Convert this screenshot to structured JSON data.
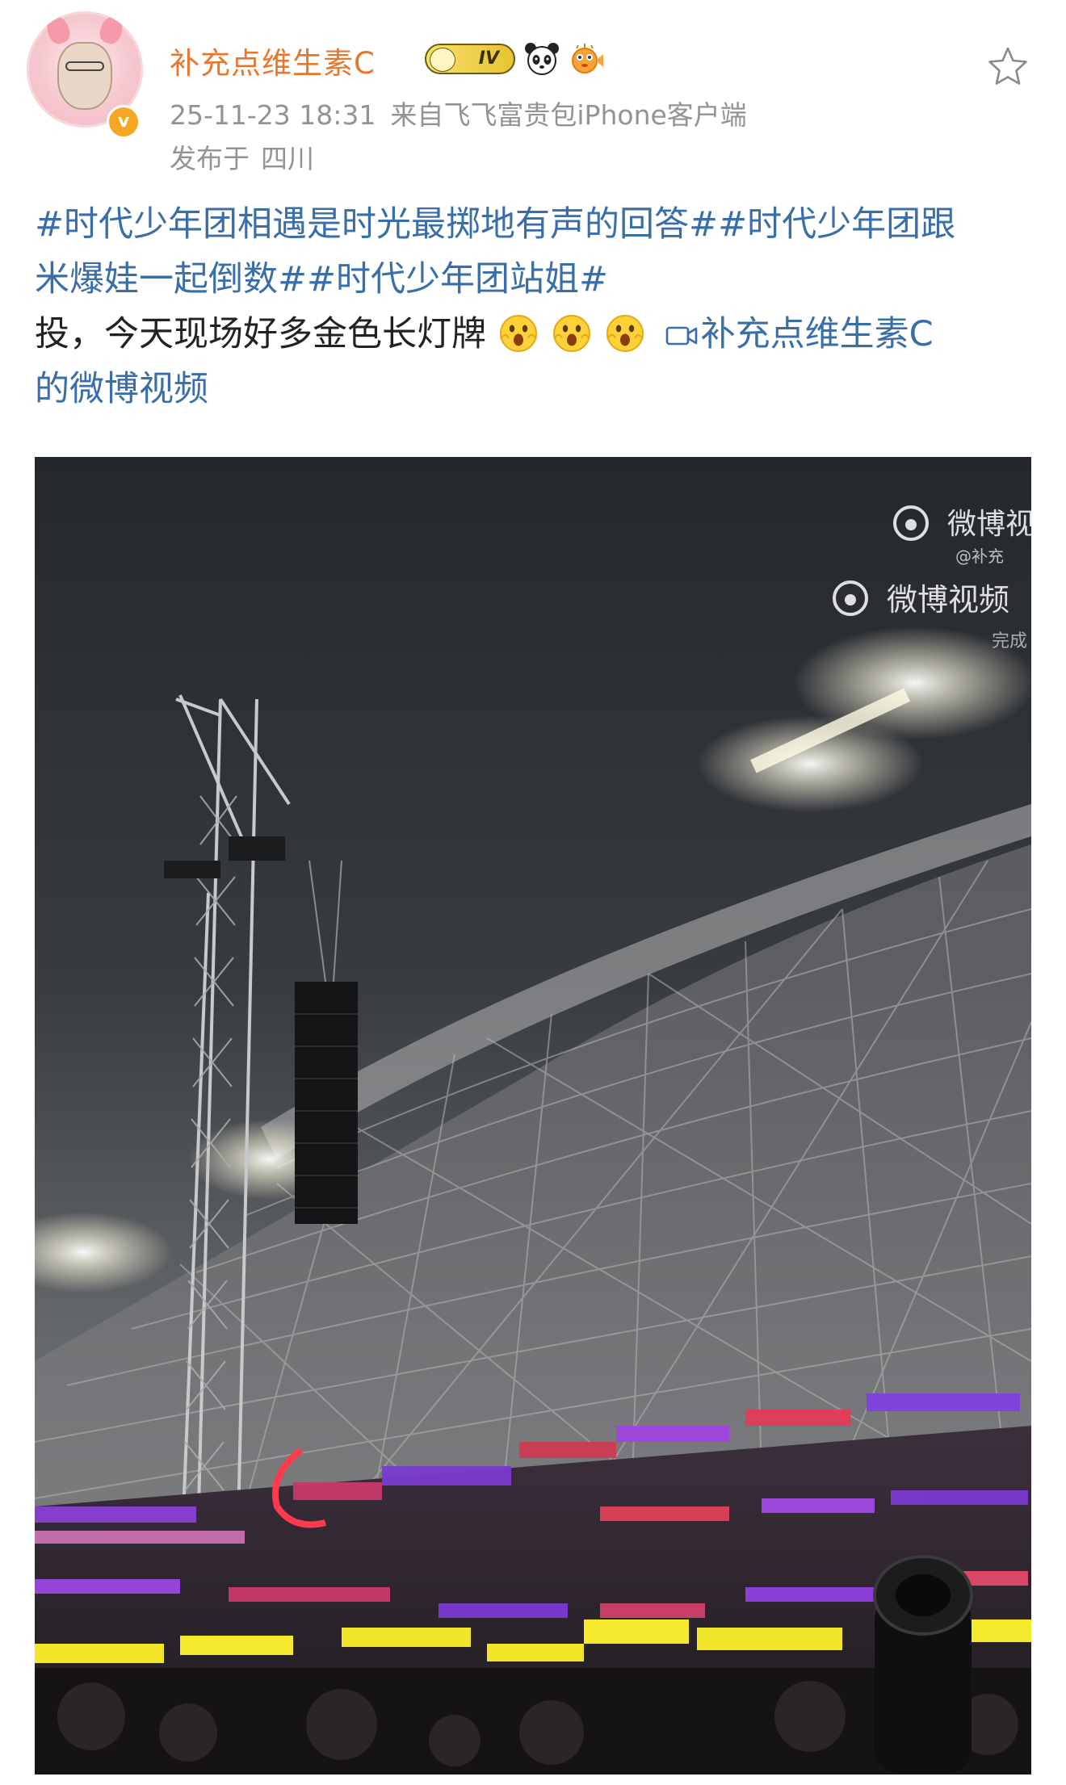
{
  "user": {
    "name": "补充点维生素C",
    "level": "IV",
    "verified_mark": "v"
  },
  "meta": {
    "timestamp": "25-11-23 18:31",
    "source": "来自飞飞富贵包iPhone客户端",
    "location_label": "发布于",
    "location": "四川"
  },
  "post": {
    "topic1": "#时代少年团相遇是时光最掷地有声的回答#",
    "topic2_part1": "#时代少年团跟",
    "topic2_part2": "米爆娃一起倒数#",
    "topic3": "#时代少年团站姐#",
    "text": "投，今天现场好多金色长灯牌",
    "video_link_part1": "补充点维生素C",
    "video_link_part2": "的微博视频"
  },
  "media": {
    "watermark_primary": "微博视",
    "watermark_secondary": "微博视频",
    "watermark_handle": "@补充",
    "watermark_cut": "完成"
  },
  "icons": {
    "favorite": "star-outline-icon",
    "panda": "panda-icon",
    "fish": "puffer-fish-icon",
    "emoji": "shocked-face-icon",
    "video": "video-camera-icon"
  },
  "colors": {
    "username": "#e8772e",
    "link": "#3a6ea8",
    "meta": "#939393"
  }
}
